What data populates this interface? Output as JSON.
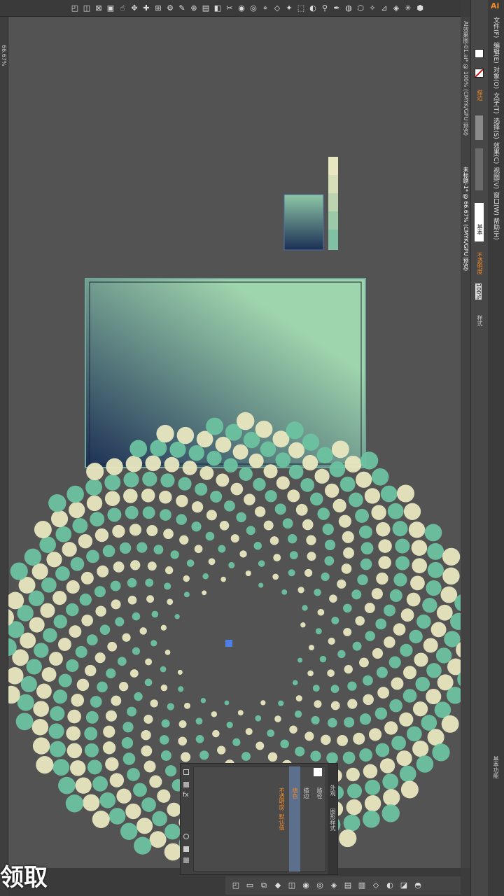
{
  "app": {
    "logo": "Ai"
  },
  "menu": [
    "文件(F)",
    "编辑(E)",
    "对象(O)",
    "文字(T)",
    "选择(S)",
    "效果(C)",
    "视图(V)",
    "窗口(W)",
    "帮助(H)"
  ],
  "workspace_label": "基本功能",
  "doc_tabs": [
    {
      "title": "AI效果图-01.ai* @ 100% (CMYK/GPU 预览)"
    },
    {
      "title": "未标题-1* @ 66.67% (CMYK/GPU 预览)"
    }
  ],
  "control": {
    "stroke_style": "基本",
    "opacity_label": "不透明度",
    "opacity": "100%",
    "style_label": "样式"
  },
  "left_ruler": {
    "zoom": "66.67%"
  },
  "appearance_panel": {
    "tabs": [
      "外观",
      "图形样式"
    ],
    "rows": [
      "路径",
      "描边",
      "填色"
    ],
    "fill_value": "不透明度: 默认值",
    "highlight": "#5c6f8c"
  },
  "colors": {
    "navy": "#1c2f55",
    "mint": "#9fd5ad",
    "cream": "#e9e7c0",
    "green": "#6cc2a0"
  },
  "subtitle": "领取"
}
